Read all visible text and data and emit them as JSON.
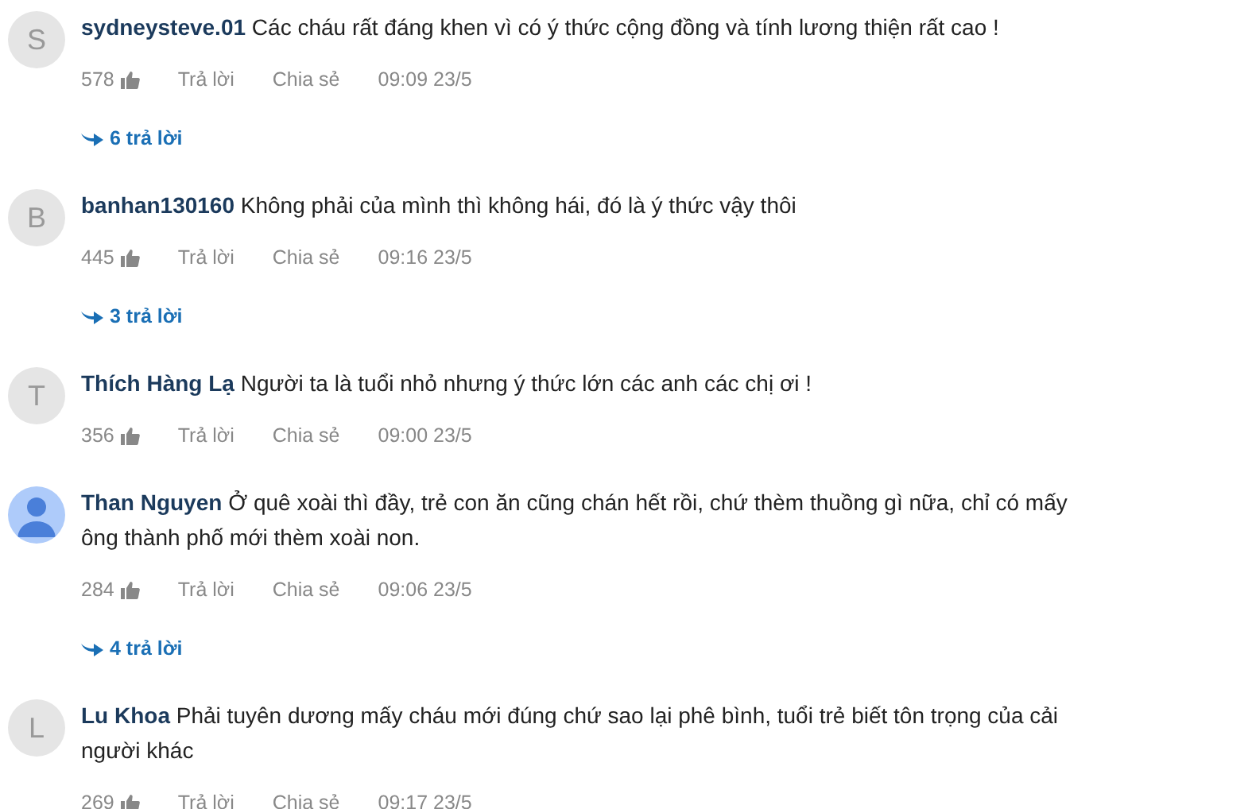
{
  "comments": [
    {
      "avatar": {
        "kind": "letter",
        "letter": "S"
      },
      "author": "sydneysteve.01",
      "text": "Các cháu rất đáng khen vì có ý thức cộng đồng và tính lương thiện rất cao !",
      "likes": "578",
      "reply": "Trả lời",
      "share": "Chia sẻ",
      "time": "09:09 23/5",
      "replies": "6 trả lời"
    },
    {
      "avatar": {
        "kind": "letter",
        "letter": "B"
      },
      "author": "banhan130160",
      "text": "Không phải của mình thì không hái, đó là ý thức vậy thôi",
      "likes": "445",
      "reply": "Trả lời",
      "share": "Chia sẻ",
      "time": "09:16 23/5",
      "replies": "3 trả lời"
    },
    {
      "avatar": {
        "kind": "letter",
        "letter": "T"
      },
      "author": "Thích Hàng Lạ",
      "text": "Người ta là tuổi nhỏ nhưng ý thức lớn các anh các chị ơi !",
      "likes": "356",
      "reply": "Trả lời",
      "share": "Chia sẻ",
      "time": "09:00 23/5"
    },
    {
      "avatar": {
        "kind": "user"
      },
      "author": "Than Nguyen",
      "text": "Ở quê xoài thì đầy, trẻ con ăn cũng chán hết rồi, chứ thèm thuồng gì nữa, chỉ có mấy ông thành phố mới thèm xoài non.",
      "likes": "284",
      "reply": "Trả lời",
      "share": "Chia sẻ",
      "time": "09:06 23/5",
      "replies": "4 trả lời"
    },
    {
      "avatar": {
        "kind": "letter",
        "letter": "L"
      },
      "author": "Lu Khoa",
      "text": "Phải tuyên dương mấy cháu mới đúng chứ sao lại phê bình, tuổi trẻ biết tôn trọng của cải người khác",
      "likes": "269",
      "reply": "Trả lời",
      "share": "Chia sẻ",
      "time": "09:17 23/5"
    }
  ]
}
